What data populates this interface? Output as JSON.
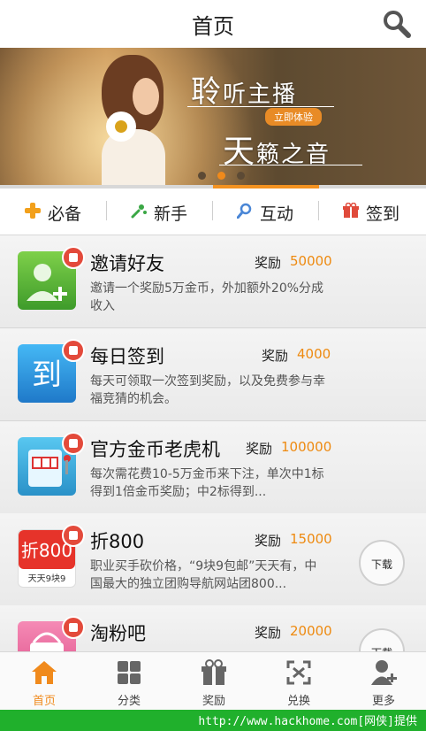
{
  "header": {
    "title": "首页",
    "search_icon": "search-icon"
  },
  "banner": {
    "line1_big": "聆",
    "line1_rest": "听主播",
    "tag": "立即体验",
    "line2_big": "天",
    "line2_rest": "籁之音"
  },
  "tabs": [
    {
      "label": "必备",
      "icon": "plus-icon"
    },
    {
      "label": "新手",
      "icon": "sparkle-icon"
    },
    {
      "label": "互动",
      "icon": "magnifier-icon"
    },
    {
      "label": "签到",
      "icon": "gift-icon"
    }
  ],
  "items": [
    {
      "name": "邀请好友",
      "reward_label": "奖励",
      "reward_value": "50000",
      "desc": "邀请一个奖励5万金币，外加额外20%分成收入"
    },
    {
      "name": "每日签到",
      "reward_label": "奖励",
      "reward_value": "4000",
      "desc": "每天可领取一次签到奖励，以及免费参与幸福竞猜的机会。"
    },
    {
      "name": "官方金币老虎机",
      "reward_label": "奖励",
      "reward_value": "100000",
      "desc": "每次需花费10-5万金币来下注，单次中1标得到1倍金币奖励；中2标得到..."
    },
    {
      "name": "折800",
      "reward_label": "奖励",
      "reward_value": "15000",
      "desc": "职业买手砍价格，“9块9包邮”天天有，中国最大的独立团购导航网站团800...",
      "download": "下载"
    },
    {
      "name": "淘粉吧",
      "reward_label": "奖励",
      "reward_value": "20000",
      "desc": "",
      "download": "下载"
    }
  ],
  "nav": [
    {
      "label": "首页",
      "icon": "home-icon"
    },
    {
      "label": "分类",
      "icon": "grid-icon"
    },
    {
      "label": "奖励",
      "icon": "gift-icon"
    },
    {
      "label": "兑换",
      "icon": "exchange-icon"
    },
    {
      "label": "更多",
      "icon": "user-plus-icon"
    }
  ],
  "footer": {
    "url": "http://www.hackhome.com[网侠]提供"
  },
  "colors": {
    "accent": "#f39220",
    "reward": "#ee8a10",
    "footer": "#20b02c"
  }
}
